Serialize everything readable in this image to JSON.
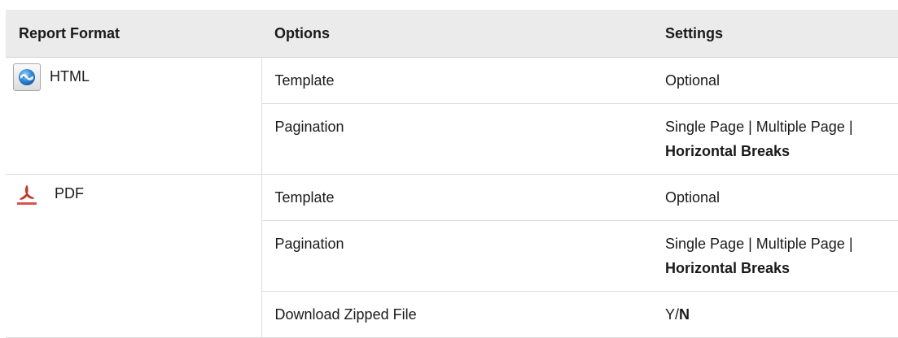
{
  "table": {
    "headers": {
      "format": "Report Format",
      "options": "Options",
      "settings": "Settings"
    },
    "html": {
      "format_label": "HTML",
      "icon": "html-globe-icon",
      "rows": [
        {
          "option": "Template",
          "setting": "Optional"
        },
        {
          "option": "Pagination",
          "setting_parts": [
            "Single Page | Multiple Page | ",
            "Horizontal Breaks"
          ]
        }
      ]
    },
    "pdf": {
      "format_label": "PDF",
      "icon": "pdf-icon",
      "rows": [
        {
          "option": "Template",
          "setting": "Optional"
        },
        {
          "option": "Pagination",
          "setting_parts": [
            "Single Page | Multiple Page | ",
            "Horizontal Breaks"
          ]
        },
        {
          "option": "Download Zipped File",
          "setting_parts": [
            "Y/",
            "N"
          ]
        }
      ]
    }
  }
}
